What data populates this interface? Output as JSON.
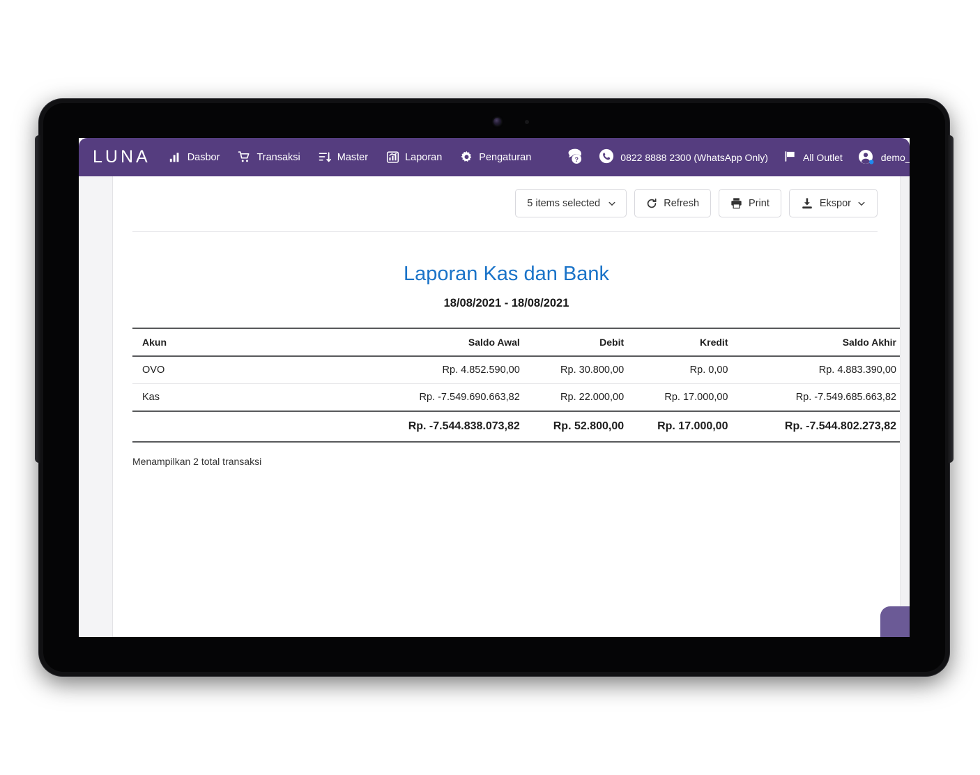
{
  "navbar": {
    "brand": "LUNA",
    "primary_items": [
      {
        "label": "Dasbor",
        "icon": "bar-chart-icon"
      },
      {
        "label": "Transaksi",
        "icon": "shopping-cart-icon"
      },
      {
        "label": "Master",
        "icon": "sort-descending-icon"
      },
      {
        "label": "Laporan",
        "icon": "report-chart-icon"
      },
      {
        "label": "Pengaturan",
        "icon": "gear-icon"
      }
    ],
    "utility_items": [
      {
        "label": "",
        "icon": "help-chat-icon"
      },
      {
        "label": "0822 8888 2300 (WhatsApp Only)",
        "icon": "whatsapp-icon"
      },
      {
        "label": "All Outlet",
        "icon": "flag-icon"
      },
      {
        "label": "demo_lunap",
        "icon": "user-avatar-icon"
      }
    ],
    "brand_color": "#553D7F"
  },
  "toolbar": {
    "items_selected": "5 items selected",
    "refresh_label": "Refresh",
    "print_label": "Print",
    "ekspor_label": "Ekspor"
  },
  "report": {
    "title": "Laporan Kas dan Bank",
    "title_color": "#1a73c8",
    "date_range": "18/08/2021 - 18/08/2021",
    "columns": [
      "Akun",
      "Saldo Awal",
      "Debit",
      "Kredit",
      "Saldo Akhir"
    ],
    "rows": [
      {
        "akun": "OVO",
        "saldo_awal": "Rp. 4.852.590,00",
        "debit": "Rp. 30.800,00",
        "kredit": "Rp. 0,00",
        "saldo_akhir": "Rp. 4.883.390,00"
      },
      {
        "akun": "Kas",
        "saldo_awal": "Rp. -7.549.690.663,82",
        "debit": "Rp. 22.000,00",
        "kredit": "Rp. 17.000,00",
        "saldo_akhir": "Rp. -7.549.685.663,82"
      }
    ],
    "totals": {
      "akun": "",
      "saldo_awal": "Rp. -7.544.838.073,82",
      "debit": "Rp. 52.800,00",
      "kredit": "Rp. 17.000,00",
      "saldo_akhir": "Rp. -7.544.802.273,82"
    },
    "footer_note": "Menampilkan 2 total transaksi"
  }
}
